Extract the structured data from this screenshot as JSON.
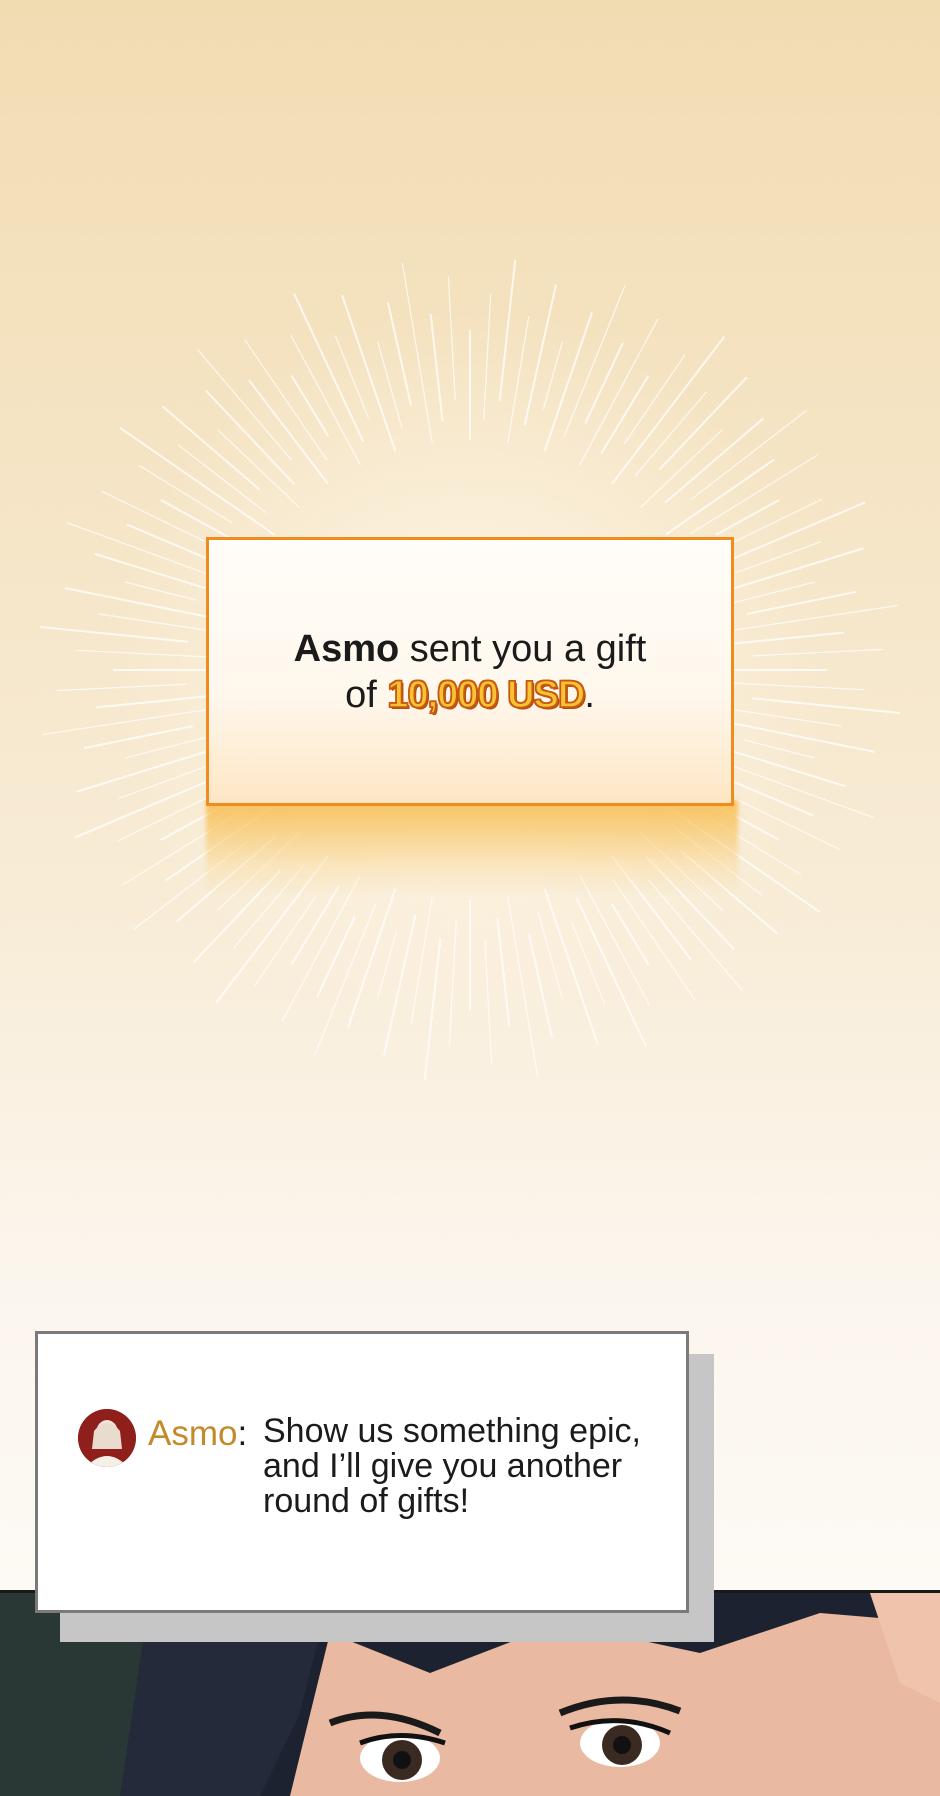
{
  "gift_notice": {
    "sender": "Asmo",
    "line1_rest": " sent you a gift",
    "line2_prefix": "of ",
    "amount": "10,000 USD",
    "line2_suffix": "."
  },
  "chat": {
    "name": "Asmo",
    "colon": ":",
    "message": "Show us something epic, and I’ll give you another round of gifts!"
  },
  "colors": {
    "accent_orange": "#f08c1d",
    "amount_gold": "#f7c335",
    "name_gold": "#c48a2a"
  }
}
